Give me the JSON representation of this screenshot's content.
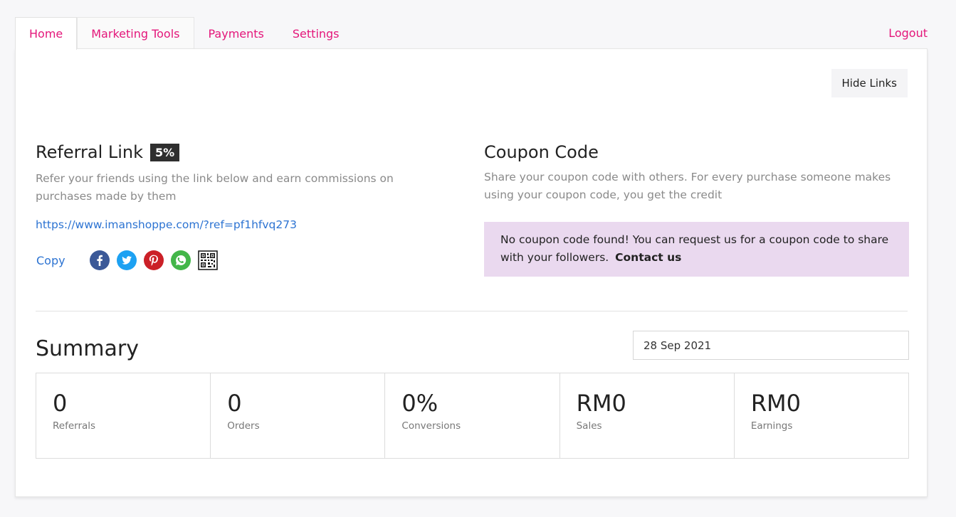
{
  "nav": {
    "tabs": [
      {
        "label": "Home"
      },
      {
        "label": "Marketing Tools"
      },
      {
        "label": "Payments"
      },
      {
        "label": "Settings"
      }
    ],
    "logout": "Logout"
  },
  "toolbar": {
    "hide_links": "Hide Links"
  },
  "referral": {
    "title": "Referral Link",
    "badge": "5%",
    "description": "Refer your friends using the link below and earn commissions on purchases made by them",
    "link": "https://www.imanshoppe.com/?ref=pf1hfvq273",
    "copy": "Copy",
    "share_icons": [
      "facebook-icon",
      "twitter-icon",
      "pinterest-icon",
      "whatsapp-icon",
      "qr-code-icon"
    ]
  },
  "coupon": {
    "title": "Coupon Code",
    "description": "Share your coupon code with others. For every purchase someone makes using your coupon code, you get the credit",
    "notice": "No coupon code found! You can request us for a coupon code to share with your followers.",
    "contact": "Contact us"
  },
  "summary": {
    "title": "Summary",
    "date": "28 Sep 2021",
    "stats": [
      {
        "value": "0",
        "label": "Referrals"
      },
      {
        "value": "0",
        "label": "Orders"
      },
      {
        "value": "0%",
        "label": "Conversions"
      },
      {
        "value": "RM0",
        "label": "Sales"
      },
      {
        "value": "RM0",
        "label": "Earnings"
      }
    ]
  },
  "colors": {
    "accent": "#e4167a",
    "link": "#2c73d2",
    "facebook": "#3b5998",
    "twitter": "#1da1f2",
    "pinterest": "#cb2027",
    "whatsapp": "#43b649",
    "coupon_bg": "#ead9ef"
  }
}
